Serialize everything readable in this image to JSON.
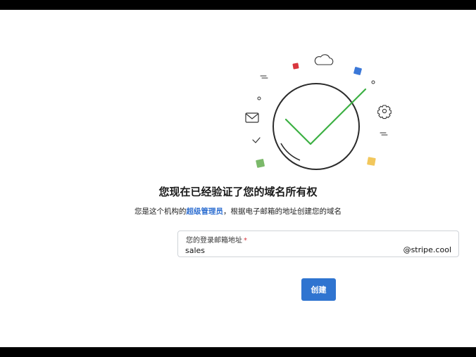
{
  "page": {
    "heading": "您现在已经验证了您的域名所有权",
    "sub_prefix": "您是这个机构的",
    "sub_role": "超级管理员",
    "sub_suffix": "，根据电子邮箱的地址创建您的域名"
  },
  "email_field": {
    "label": "您的登录邮箱地址",
    "required_mark": "*",
    "value": "sales",
    "suffix": "@stripe.cool"
  },
  "actions": {
    "create_label": "创建",
    "create_color": "#2f74d0"
  },
  "illustration": {
    "icons": [
      "checkmark-circle-icon",
      "cloud-icon",
      "envelope-icon",
      "gear-icon",
      "small-check-icon"
    ],
    "accent_colors": [
      "#d9363e",
      "#3b78d8",
      "#7bb96a",
      "#f2c75c",
      "#3cb043"
    ]
  }
}
